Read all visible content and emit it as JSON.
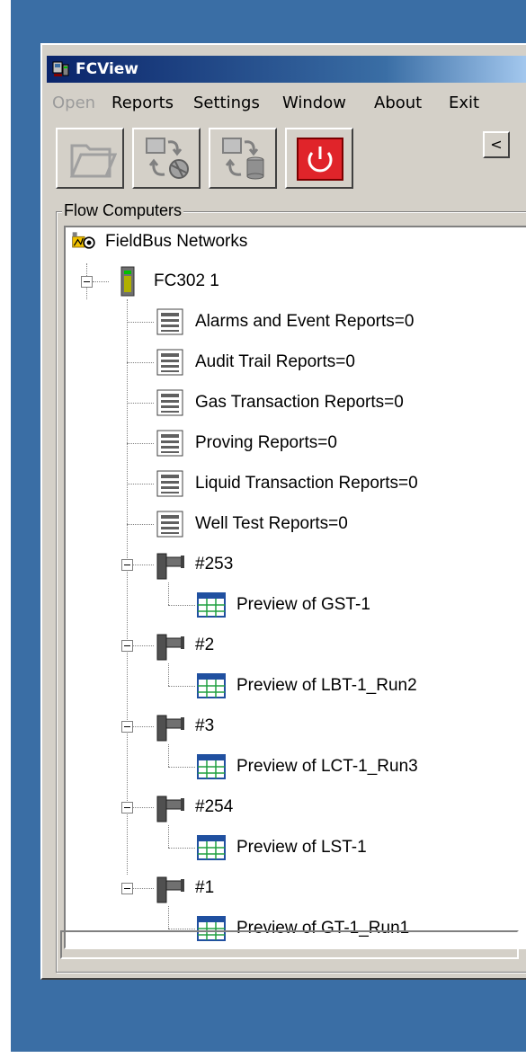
{
  "window": {
    "title": "FCView"
  },
  "menu": {
    "open": "Open",
    "reports": "Reports",
    "settings": "Settings",
    "window": "Window",
    "about": "About",
    "exit": "Exit"
  },
  "toolbar": {
    "buttons": [
      "open-folder-icon",
      "network-transfer-icon",
      "database-transfer-icon",
      "power-icon"
    ],
    "collapse_label": "<"
  },
  "panel": {
    "group_label": "Flow Computers"
  },
  "tree": {
    "root": "FieldBus Networks",
    "device": "FC302 1",
    "reports": [
      "Alarms and Event Reports=0",
      "Audit Trail Reports=0",
      "Gas Transaction Reports=0",
      "Proving Reports=0",
      "Liquid Transaction Reports=0",
      "Well Test Reports=0"
    ],
    "runs": [
      {
        "name": "#253",
        "preview": "Preview of GST-1"
      },
      {
        "name": "#2",
        "preview": "Preview of LBT-1_Run2"
      },
      {
        "name": "#3",
        "preview": "Preview of LCT-1_Run3"
      },
      {
        "name": "#254",
        "preview": "Preview of LST-1"
      },
      {
        "name": "#1",
        "preview": "Preview of GT-1_Run1"
      }
    ]
  },
  "colors": {
    "desktop": "#3a6ea5",
    "titlebar": "#0a246a",
    "power_button": "#e0242a"
  }
}
